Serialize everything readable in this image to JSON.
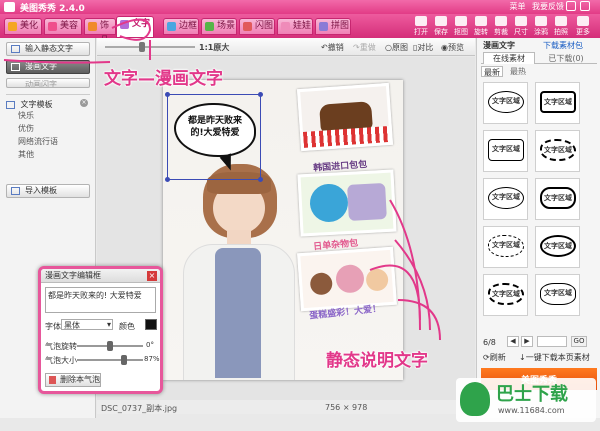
{
  "window": {
    "title": "美图秀秀 2.4.0",
    "menu": "菜单",
    "feedback": "我要反馈"
  },
  "tabs": [
    {
      "label": "美化",
      "color": "#f5a623"
    },
    {
      "label": "美容",
      "color": "#ef4f8c"
    },
    {
      "label": "饰品",
      "color": "#f08a2a"
    },
    {
      "label": "文字",
      "color": "#b36ad8"
    },
    {
      "label": "边框",
      "color": "#4aa6e0"
    },
    {
      "label": "场景",
      "color": "#56b548"
    },
    {
      "label": "闪图",
      "color": "#e15a5a"
    },
    {
      "label": "娃娃",
      "color": "#ef8bb9"
    },
    {
      "label": "拼图",
      "color": "#8b7bd6"
    }
  ],
  "toolbar_actions": [
    "打开",
    "保存",
    "抠图",
    "旋转",
    "剪裁",
    "尺寸",
    "涂鸦",
    "拍照",
    "更多"
  ],
  "left_panel": {
    "btn_static_text": "输入静态文字",
    "btn_comic_text": "漫画文字",
    "btn_animated": "动画闪字",
    "section_title": "文字模板",
    "items": [
      "快乐",
      "优伤",
      "网络流行语",
      "其他"
    ],
    "btn_import": "导入模板"
  },
  "canvas_toolbar": {
    "zoom_label": "1:1原大",
    "undo": "撤销",
    "redo": "重做",
    "original": "原图",
    "compare": "对比",
    "preview": "预览"
  },
  "photo": {
    "bubble_text": "都是昨天败来的!大爱特爱",
    "caption1": "韩国进口包包",
    "caption2": "日单杂物包",
    "caption3": "蛋糕盛彩！大爱！"
  },
  "annotations": {
    "comic": "文字—漫画文字",
    "static": "静态说明文字"
  },
  "dialog": {
    "title": "漫画文字编辑框",
    "text_value": "都是昨天败来的! 大爱特爱",
    "font_label": "字体",
    "font_value": "黑体",
    "color_label": "颜色",
    "rotate_label": "气泡旋转",
    "rotate_value": "0°",
    "size_label": "气泡大小",
    "size_value": "87%",
    "delete_button": "删除本气泡"
  },
  "status": {
    "filename": "DSC_0737_副本.jpg",
    "dimensions": "756 × 978"
  },
  "right_panel": {
    "tab_comic": "漫画文字",
    "tab_download": "下载素材包",
    "subtab_online": "在线素材",
    "subtab_downloaded": "已下载(0)",
    "filter_new": "最新",
    "filter_hot": "最热",
    "bubble_label": "文字区域",
    "page": "6/8",
    "refresh": "刷新",
    "download_all": "一键下载本页素材",
    "promo": "美图秀秀",
    "go": "GO"
  },
  "watermark": {
    "brand": "巴士下载",
    "url": "www.11684.com"
  }
}
